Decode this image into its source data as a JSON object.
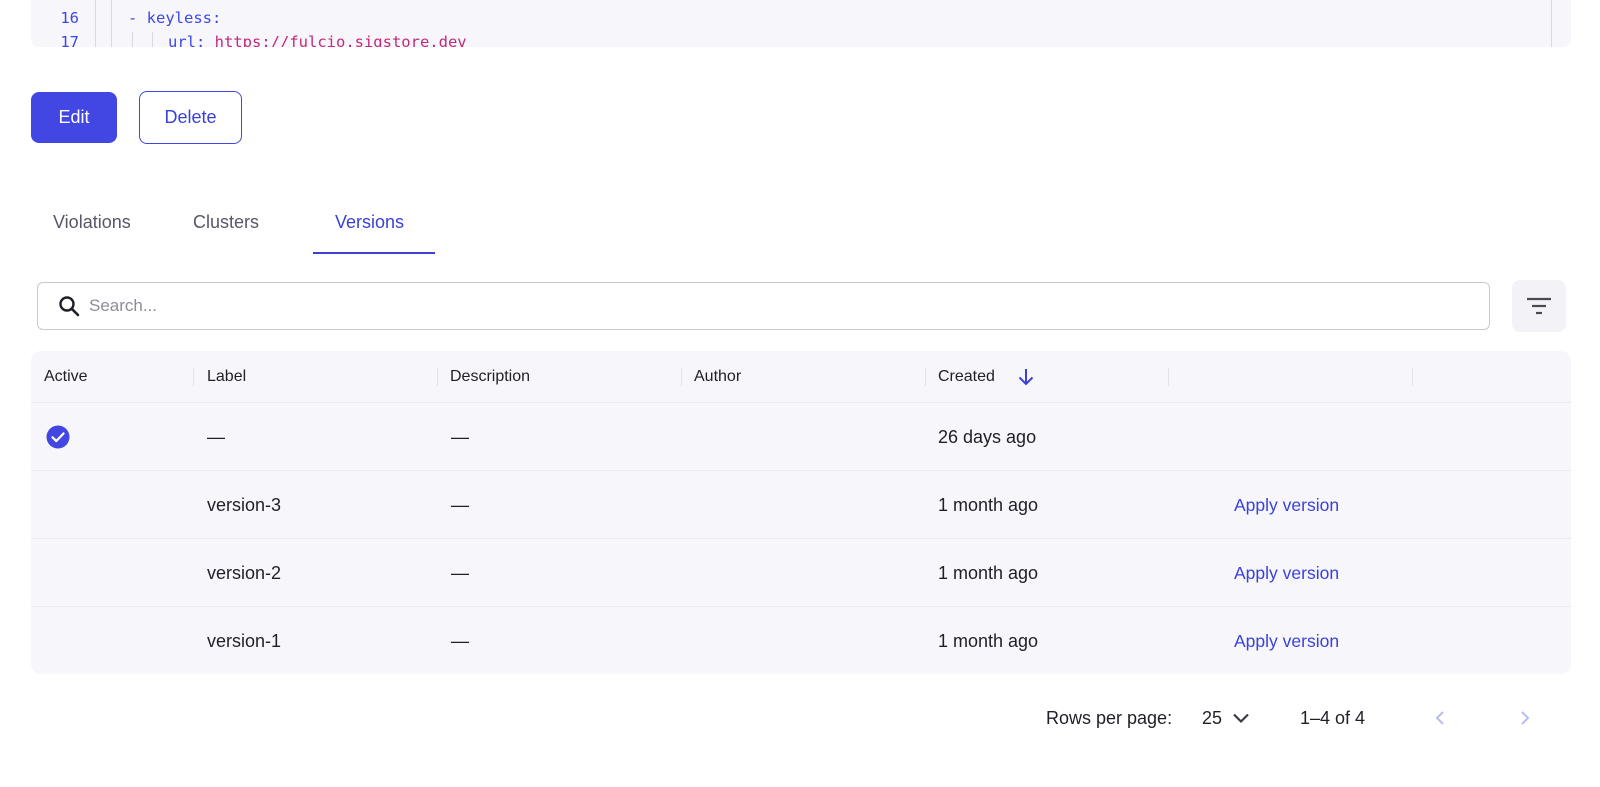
{
  "code": {
    "lines": [
      {
        "number": "16",
        "punct": "- ",
        "key": "keyless:",
        "value": ""
      },
      {
        "number": "17",
        "punct": "",
        "key": "url: ",
        "value": "https://fulcio.sigstore.dev"
      }
    ]
  },
  "actions": {
    "edit_label": "Edit",
    "delete_label": "Delete"
  },
  "tabs": [
    {
      "label": "Violations",
      "active": false
    },
    {
      "label": "Clusters",
      "active": false
    },
    {
      "label": "Versions",
      "active": true
    }
  ],
  "search": {
    "placeholder": "Search...",
    "value": ""
  },
  "filter_icon": "filter-icon",
  "table": {
    "columns": [
      "Active",
      "Label",
      "Description",
      "Author",
      "Created",
      "",
      ""
    ],
    "sort": {
      "column": "Created",
      "direction": "descending",
      "icon": "arrow-down-icon"
    },
    "rows": [
      {
        "active": true,
        "label": "—",
        "description": "—",
        "author": "",
        "created": "26 days ago",
        "action": ""
      },
      {
        "active": false,
        "label": "version-3",
        "description": "—",
        "author": "",
        "created": "1 month ago",
        "action": "Apply version"
      },
      {
        "active": false,
        "label": "version-2",
        "description": "—",
        "author": "",
        "created": "1 month ago",
        "action": "Apply version"
      },
      {
        "active": false,
        "label": "version-1",
        "description": "—",
        "author": "",
        "created": "1 month ago",
        "action": "Apply version"
      }
    ]
  },
  "pagination": {
    "rows_per_page_label": "Rows per page:",
    "rows_per_page_value": "25",
    "range": "1–4 of 4"
  },
  "colors": {
    "accent": "#4246e3",
    "link": "#3a41d9",
    "code_string": "#c3287c"
  }
}
